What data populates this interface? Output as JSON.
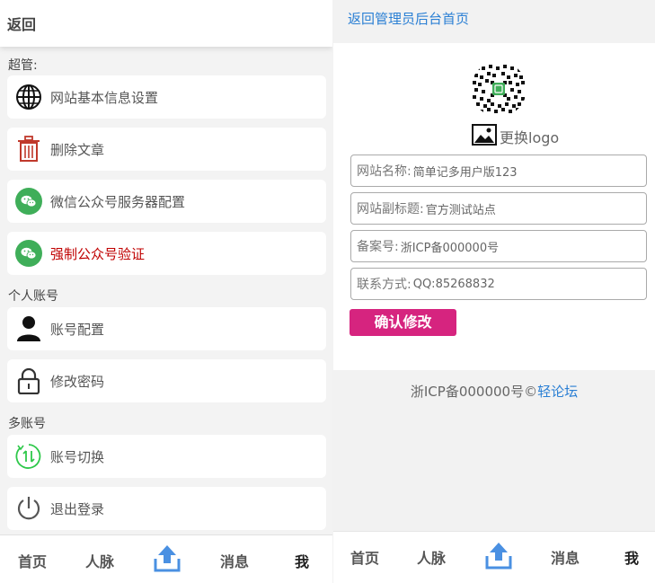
{
  "left": {
    "back_label": "返回",
    "sections": {
      "admin": "超管:",
      "personal": "个人账号",
      "multi": "多账号"
    },
    "items": {
      "site_settings": "网站基本信息设置",
      "delete_article": "删除文章",
      "wechat_server": "微信公众号服务器配置",
      "force_verify": "强制公众号验证",
      "account_config": "账号配置",
      "change_password": "修改密码",
      "switch_account": "账号切换",
      "logout": "退出登录"
    },
    "tabs": {
      "home": "首页",
      "contacts": "人脉",
      "messages": "消息",
      "me": "我"
    }
  },
  "right": {
    "admin_home_link": "返回管理员后台首页",
    "change_logo": "更换logo",
    "fields": {
      "site_name_label": "网站名称:",
      "site_name_value": "简单记多用户版123",
      "subtitle_label": "网站副标题:",
      "subtitle_value": "官方测试站点",
      "icp_label": "备案号:",
      "icp_value": "浙ICP备000000号",
      "contact_label": "联系方式:",
      "contact_value": "QQ:85268832"
    },
    "confirm_label": "确认修改",
    "footer_text": "浙ICP备000000号©",
    "footer_link": "轻论坛",
    "tabs": {
      "home": "首页",
      "contacts": "人脉",
      "messages": "消息",
      "me": "我"
    }
  },
  "colors": {
    "link_blue": "#2a7fd4",
    "wechat_green": "#3fae59",
    "alert_red": "#c00000",
    "confirm_pink": "#d6247f",
    "upload_blue": "#4a90e2"
  }
}
